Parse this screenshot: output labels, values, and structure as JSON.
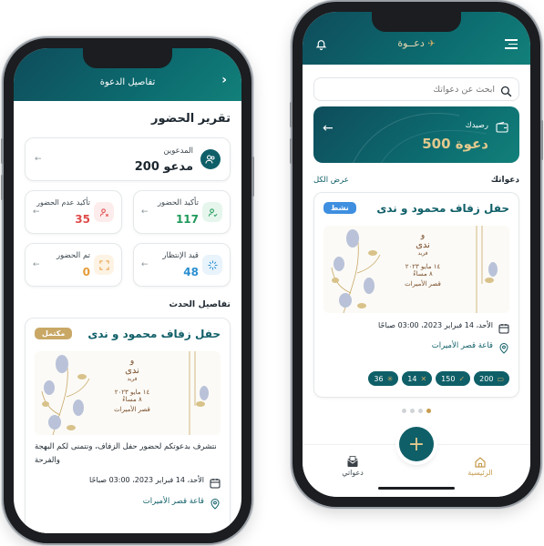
{
  "left": {
    "header_title": "تفاصيل الدعوة",
    "back_icon": "chevron-right-icon",
    "report_title": "تقرير الحضور",
    "invitees": {
      "label": "المدعوين",
      "value": "200 مدعو"
    },
    "stats": [
      {
        "label": "تأكيد الحضور",
        "value": "117",
        "color": "#1f9a5a",
        "icon": "user-check-icon"
      },
      {
        "label": "تأكيد عدم الحضور",
        "value": "35",
        "color": "#e04a4a",
        "icon": "user-x-icon"
      },
      {
        "label": "قيد الإنتظار",
        "value": "48",
        "color": "#2b8fd0",
        "icon": "loader-icon"
      },
      {
        "label": "تم الحضور",
        "value": "0",
        "color": "#e59c3a",
        "icon": "scan-icon"
      }
    ],
    "event_details_title": "تفاصيل الحدث",
    "event": {
      "name": "حفل زفاف محمود و ندى",
      "status": "مكتمل",
      "card_line1": "و",
      "card_line2": "ندى",
      "card_line3": "فريد",
      "card_line4": "١٤ مايو ٢٠٢٣",
      "card_line5": "٨ مساءً",
      "card_line6": "قصر الأميرات",
      "description": "نتشرف بدعوتكم لحضور حفل الزفاف، ونتمنى لكم البهجة والفرحة",
      "date": "الأحد، 14 فبراير 2023، 03:00 صباحًا",
      "venue": "قاعة قصر الأميرات"
    }
  },
  "right": {
    "brand": "دعــوة",
    "search_placeholder": "ابحث عن دعواتك",
    "balance_label": "رصيدك",
    "balance_value": "500 دعوة",
    "invitations_title": "دعواتك",
    "view_all": "عرض الكل",
    "event": {
      "name": "حفل زفاف محمود و ندى",
      "status": "نشط",
      "card_line1": "و",
      "card_line2": "ندى",
      "card_line3": "فريد",
      "card_line4": "١٤ مايو ٢٠٢٣",
      "card_line5": "٨ مساءً",
      "card_line6": "قصر الأميرات",
      "date": "الأحد، 14 فبراير 2023، 03:00 صباحًا",
      "venue": "قاعة قصر الأميرات"
    },
    "chips": [
      {
        "value": "200",
        "icon": "ticket-icon"
      },
      {
        "value": "150",
        "icon": "user-check-icon"
      },
      {
        "value": "14",
        "icon": "user-x-icon"
      },
      {
        "value": "36",
        "icon": "loader-icon"
      }
    ],
    "nav": {
      "home": "الرئيسية",
      "add": "+",
      "my_invites": "دعواتي"
    }
  },
  "colors": {
    "teal": "#0f5f68",
    "gold": "#c9a866",
    "accent_gold": "#c69b4d",
    "active_blue": "#3f8fe0"
  }
}
